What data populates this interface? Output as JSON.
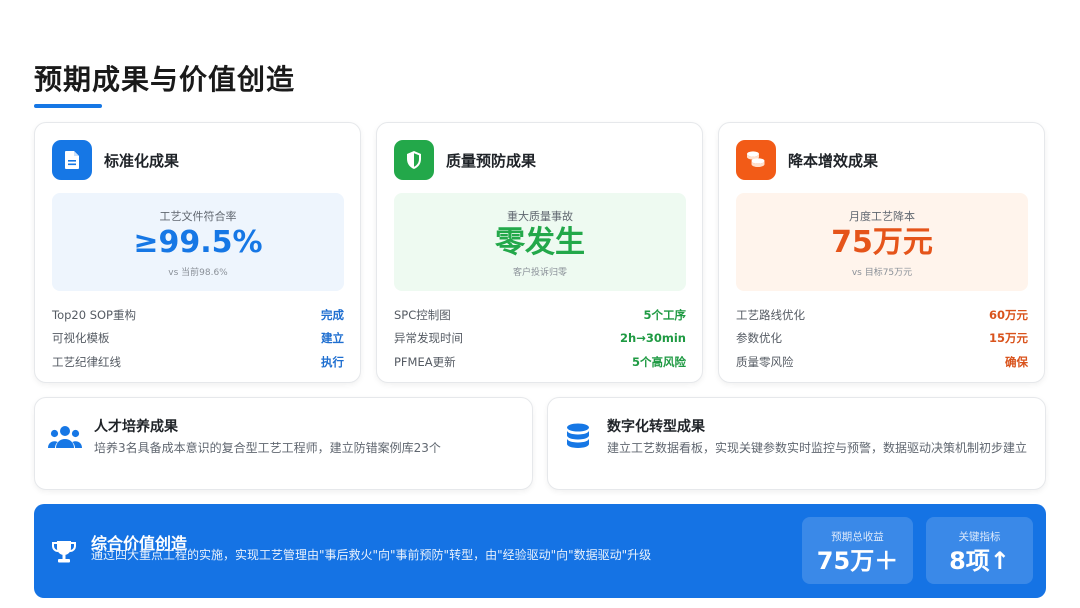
{
  "page": {
    "title": "预期成果与价值创造"
  },
  "cards": [
    {
      "title": "标准化成果",
      "icon": "document-icon",
      "accent": "#1677e5",
      "metric": {
        "label": "工艺文件符合率",
        "value": "≥99.5%",
        "sub": "vs 当前98.6%"
      },
      "rows": [
        {
          "label": "Top20 SOP重构",
          "value": "完成"
        },
        {
          "label": "可视化模板",
          "value": "建立"
        },
        {
          "label": "工艺纪律红线",
          "value": "执行"
        }
      ]
    },
    {
      "title": "质量预防成果",
      "icon": "shield-check-icon",
      "accent": "#23a84a",
      "metric": {
        "label": "重大质量事故",
        "value": "零发生",
        "sub": "客户投诉归零"
      },
      "rows": [
        {
          "label": "SPC控制图",
          "value": "5个工序"
        },
        {
          "label": "异常发现时间",
          "value": "2h→30min"
        },
        {
          "label": "PFMEA更新",
          "value": "5个高风险"
        }
      ]
    },
    {
      "title": "降本增效成果",
      "icon": "coins-icon",
      "accent": "#f25b17",
      "metric": {
        "label": "月度工艺降本",
        "value": "75万元",
        "sub": "vs 目标75万元"
      },
      "rows": [
        {
          "label": "工艺路线优化",
          "value": "60万元"
        },
        {
          "label": "参数优化",
          "value": "15万元"
        },
        {
          "label": "质量零风险",
          "value": "确保"
        }
      ]
    }
  ],
  "mid": [
    {
      "title": "人才培养成果",
      "icon": "users-icon",
      "text": "培养3名具备成本意识的复合型工艺工程师，建立防错案例库23个"
    },
    {
      "title": "数字化转型成果",
      "icon": "database-icon",
      "text": "建立工艺数据看板，实现关键参数实时监控与预警，数据驱动决策机制初步建立"
    }
  ],
  "banner": {
    "title": "综合价值创造",
    "icon": "trophy-icon",
    "text": "通过四大重点工程的实施，实现工艺管理由\"事后救火\"向\"事前预防\"转型，由\"经验驱动\"向\"数据驱动\"升级",
    "stats": [
      {
        "label": "预期总收益",
        "value": "75万＋"
      },
      {
        "label": "关键指标",
        "value": "8项↑"
      }
    ]
  }
}
